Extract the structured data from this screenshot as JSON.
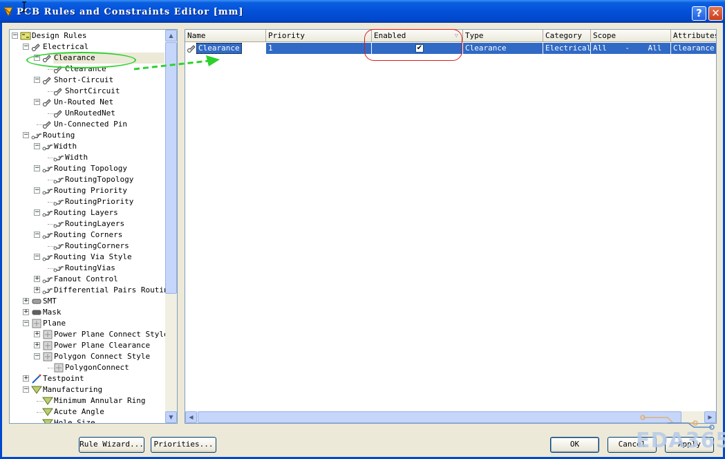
{
  "window": {
    "title": "PCB Rules and Constraints Editor [mm]",
    "help_glyph": "?",
    "close_glyph": "✕"
  },
  "tree": {
    "items": [
      {
        "label": "Design Rules",
        "level": 0,
        "expander": "−",
        "icon": "design-rules-icon"
      },
      {
        "label": "Electrical",
        "level": 1,
        "expander": "−",
        "icon": "electrical-icon"
      },
      {
        "label": "Clearance",
        "level": 2,
        "expander": "−",
        "icon": "clearance-icon",
        "selected": true
      },
      {
        "label": "Clearance",
        "level": 3,
        "expander": "",
        "icon": "clearance-rule-icon"
      },
      {
        "label": "Short-Circuit",
        "level": 2,
        "expander": "−",
        "icon": "short-circuit-icon"
      },
      {
        "label": "ShortCircuit",
        "level": 3,
        "expander": "",
        "icon": "short-circuit-rule-icon"
      },
      {
        "label": "Un-Routed Net",
        "level": 2,
        "expander": "−",
        "icon": "unrouted-net-icon"
      },
      {
        "label": "UnRoutedNet",
        "level": 3,
        "expander": "",
        "icon": "unrouted-net-rule-icon"
      },
      {
        "label": "Un-Connected Pin",
        "level": 2,
        "expander": "",
        "icon": "unconnected-pin-icon"
      },
      {
        "label": "Routing",
        "level": 1,
        "expander": "−",
        "icon": "routing-icon"
      },
      {
        "label": "Width",
        "level": 2,
        "expander": "−",
        "icon": "width-icon"
      },
      {
        "label": "Width",
        "level": 3,
        "expander": "",
        "icon": "width-rule-icon"
      },
      {
        "label": "Routing Topology",
        "level": 2,
        "expander": "−",
        "icon": "routing-topology-icon"
      },
      {
        "label": "RoutingTopology",
        "level": 3,
        "expander": "",
        "icon": "routing-topology-rule-icon"
      },
      {
        "label": "Routing Priority",
        "level": 2,
        "expander": "−",
        "icon": "routing-priority-icon"
      },
      {
        "label": "RoutingPriority",
        "level": 3,
        "expander": "",
        "icon": "routing-priority-rule-icon"
      },
      {
        "label": "Routing Layers",
        "level": 2,
        "expander": "−",
        "icon": "routing-layers-icon"
      },
      {
        "label": "RoutingLayers",
        "level": 3,
        "expander": "",
        "icon": "routing-layers-rule-icon"
      },
      {
        "label": "Routing Corners",
        "level": 2,
        "expander": "−",
        "icon": "routing-corners-icon"
      },
      {
        "label": "RoutingCorners",
        "level": 3,
        "expander": "",
        "icon": "routing-corners-rule-icon"
      },
      {
        "label": "Routing Via Style",
        "level": 2,
        "expander": "−",
        "icon": "routing-via-style-icon"
      },
      {
        "label": "RoutingVias",
        "level": 3,
        "expander": "",
        "icon": "routing-vias-rule-icon"
      },
      {
        "label": "Fanout Control",
        "level": 2,
        "expander": "+",
        "icon": "fanout-control-icon"
      },
      {
        "label": "Differential Pairs Routing",
        "level": 2,
        "expander": "+",
        "icon": "differential-pairs-icon"
      },
      {
        "label": "SMT",
        "level": 1,
        "expander": "+",
        "icon": "smt-icon"
      },
      {
        "label": "Mask",
        "level": 1,
        "expander": "+",
        "icon": "mask-icon"
      },
      {
        "label": "Plane",
        "level": 1,
        "expander": "−",
        "icon": "plane-icon"
      },
      {
        "label": "Power Plane Connect Style",
        "level": 2,
        "expander": "+",
        "icon": "power-plane-connect-icon"
      },
      {
        "label": "Power Plane Clearance",
        "level": 2,
        "expander": "+",
        "icon": "power-plane-clearance-icon"
      },
      {
        "label": "Polygon Connect Style",
        "level": 2,
        "expander": "−",
        "icon": "polygon-connect-icon"
      },
      {
        "label": "PolygonConnect",
        "level": 3,
        "expander": "",
        "icon": "polygon-connect-rule-icon"
      },
      {
        "label": "Testpoint",
        "level": 1,
        "expander": "+",
        "icon": "testpoint-icon"
      },
      {
        "label": "Manufacturing",
        "level": 1,
        "expander": "−",
        "icon": "manufacturing-icon"
      },
      {
        "label": "Minimum Annular Ring",
        "level": 2,
        "expander": "",
        "icon": "annular-ring-icon"
      },
      {
        "label": "Acute Angle",
        "level": 2,
        "expander": "",
        "icon": "acute-angle-icon"
      },
      {
        "label": "Hole Size",
        "level": 2,
        "expander": "",
        "icon": "hole-size-icon"
      }
    ]
  },
  "grid": {
    "columns": [
      "Name",
      "Priority",
      "Enabled",
      "Type",
      "Category",
      "Scope",
      "Attributes"
    ],
    "sort_glyph": "▽",
    "rows": [
      {
        "name": "Clearance",
        "priority": "1",
        "enabled": "✔",
        "type": "Clearance",
        "category": "Electrical",
        "scope": "All    -    All",
        "attributes": "Clearance ="
      }
    ]
  },
  "buttons": {
    "rule_wizard": "Rule Wizard...",
    "priorities": "Priorities...",
    "ok": "OK",
    "cancel": "Cancel",
    "apply": "Apply"
  },
  "scroll_glyphs": {
    "up": "▲",
    "down": "▼",
    "left": "◀",
    "right": "▶"
  },
  "watermark": "EDA365",
  "colors": {
    "title_bar": "#0450d8",
    "selection": "#316ac5",
    "annotation_green": "#2cd12c",
    "annotation_red": "#e01818",
    "watermark": "#b6cbe8"
  }
}
